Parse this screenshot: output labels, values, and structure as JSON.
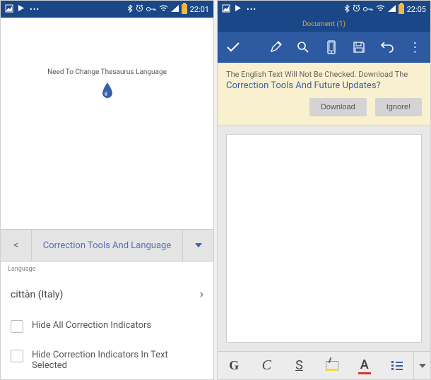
{
  "left": {
    "status": {
      "time": "22:01"
    },
    "hint": "Need To Change Thesaurus Language",
    "toolbar": {
      "title": "Correction Tools And Language"
    },
    "section_label": "Language",
    "language": "cittàn (Italy)",
    "check1": "Hide All Correction Indicators",
    "check2": "Hide Correction Indicators In Text Selected"
  },
  "right": {
    "status": {
      "time": "22:05"
    },
    "doc_title": "Document (1)",
    "notice": {
      "line1": "The English Text Will Not Be Checked. Download The",
      "line2": "Correction Tools And Future Updates?",
      "download": "Download",
      "ignore": "Ignore!"
    },
    "format": {
      "bold": "G",
      "italic": "C",
      "underline": "S",
      "font_a": "A"
    }
  }
}
